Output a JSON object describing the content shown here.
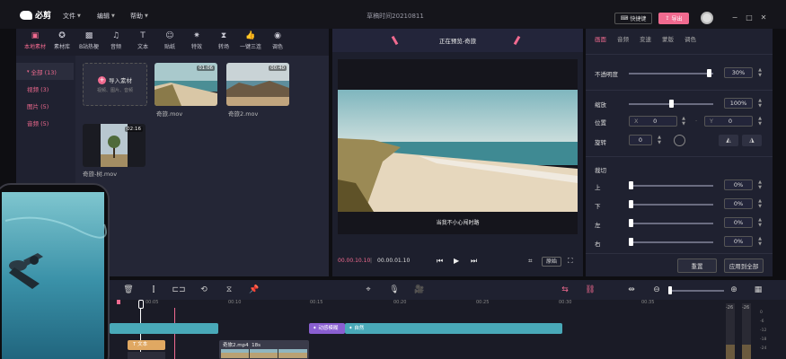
{
  "app": {
    "name": "必剪",
    "doc_title": "草稿时间20210811",
    "menu": [
      "文件",
      "编辑",
      "帮助"
    ],
    "shortcut_label": "快捷键",
    "export_label": "导出"
  },
  "toolbar": [
    "本地素材",
    "素材库",
    "B站热梗",
    "音频",
    "文本",
    "贴纸",
    "特效",
    "转场",
    "一键三连",
    "调色"
  ],
  "sidebar": [
    "全部 (13)",
    "视频 (3)",
    "图片 (5)",
    "音频 (5)"
  ],
  "import_card": {
    "title": "导入素材",
    "subtitle": "视频、图片、音频"
  },
  "media": [
    {
      "name": "奇旅.mov",
      "duration": "01:06"
    },
    {
      "name": "奇旅2.mov",
      "duration": "00:40"
    },
    {
      "name": "奇旅-树.mov",
      "duration": "02:16"
    }
  ],
  "preview": {
    "title": "正在预览-奇旅",
    "subtitle": "当我不小心闯时路",
    "time_current": "00.00.10.10",
    "time_total": "00.00.01.10",
    "original_label": "原始"
  },
  "right_tabs": [
    "画面",
    "音频",
    "变速",
    "蒙版",
    "调色"
  ],
  "props": {
    "opacity_label": "不透明度",
    "opacity_value": "30%",
    "opacity_level": 0.95,
    "scale_label": "缩放",
    "scale_value": "100%",
    "scale_level": 0.5,
    "position_label": "位置",
    "pos_x_label": "X",
    "pos_x": "0",
    "pos_y_label": "Y",
    "pos_y": "0",
    "rotate_label": "旋转",
    "rotate_value": "0",
    "crop_label": "裁切",
    "crop": [
      {
        "label": "上",
        "value": "0%"
      },
      {
        "label": "下",
        "value": "0%"
      },
      {
        "label": "左",
        "value": "0%"
      },
      {
        "label": "右",
        "value": "0%"
      }
    ],
    "reset_label": "重置",
    "apply_all_label": "应用到全部"
  },
  "timeline": {
    "ruler": [
      "00:05",
      "00:10",
      "00:15",
      "00:20",
      "00:25",
      "00:30",
      "00:35"
    ],
    "clip_effect": "动感模糊",
    "clip_natural": "自然",
    "clip_text": "文本",
    "clip_video": "奇旅2.mp4",
    "clip_video_dur": "18s",
    "meter_top": [
      "-26",
      "-26"
    ],
    "meter_ticks": [
      "0",
      "-6",
      "-12",
      "-18",
      "-24",
      "-30"
    ]
  }
}
